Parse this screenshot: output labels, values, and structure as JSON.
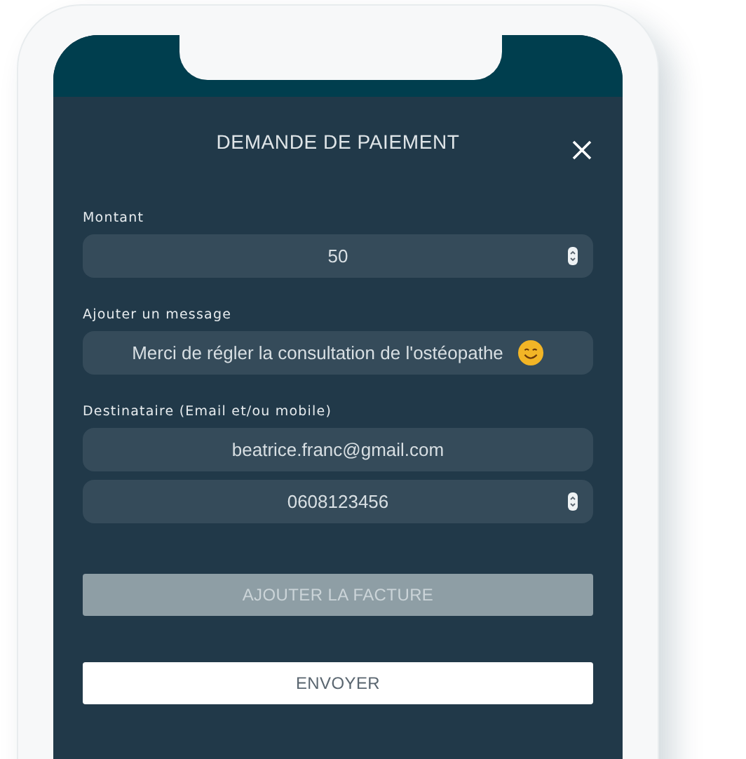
{
  "title": "DEMANDE DE PAIEMENT",
  "sections": [
    {
      "label": "Montant",
      "fields": [
        {
          "value": "50",
          "kind": "number"
        }
      ]
    },
    {
      "label": "Ajouter un message",
      "fields": [
        {
          "value": "Merci de régler la consultation de l'ostéopathe",
          "kind": "emoji-text"
        }
      ]
    },
    {
      "label": "Destinataire (Email et/ou mobile)",
      "fields": [
        {
          "value": "beatrice.franc@gmail.com",
          "kind": "text"
        },
        {
          "value": "0608123456",
          "kind": "number"
        }
      ]
    }
  ],
  "buttons": [
    {
      "label": "AJOUTER LA FACTURE",
      "disabled": true
    },
    {
      "label": "ENVOYER",
      "disabled": false
    }
  ]
}
